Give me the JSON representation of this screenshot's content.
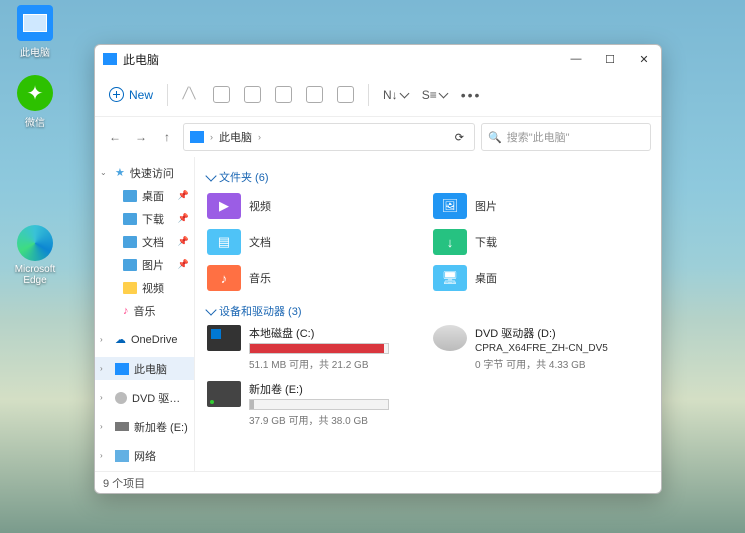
{
  "desktop": {
    "thispc": "此电脑",
    "wechat": "微信",
    "edge1": "Microsoft",
    "edge2": "Edge"
  },
  "window": {
    "title": "此电脑",
    "new_btn": "New",
    "sort": "N↓",
    "view": "S≡",
    "breadcrumb_label": "此电脑",
    "search_placeholder": "搜索\"此电脑\"",
    "status": "9 个项目"
  },
  "sidebar": {
    "quick": "快速访问",
    "desktop": "桌面",
    "downloads": "下载",
    "documents": "文档",
    "pictures": "图片",
    "videos": "视频",
    "music": "音乐",
    "onedrive": "OneDrive",
    "thispc": "此电脑",
    "dvd": "DVD 驱动器 (D:)",
    "newvol": "新加卷 (E:)",
    "network": "网络"
  },
  "sections": {
    "folders": "文件夹 (6)",
    "drives": "设备和驱动器 (3)"
  },
  "folders": {
    "videos": "视频",
    "pictures": "图片",
    "documents": "文档",
    "downloads": "下载",
    "music": "音乐",
    "desktop": "桌面"
  },
  "drives": {
    "c_name": "本地磁盘 (C:)",
    "c_sub": "51.1 MB 可用，共 21.2 GB",
    "d_name": "DVD 驱动器 (D:)",
    "d_sub1": "CPRA_X64FRE_ZH-CN_DV5",
    "d_sub2": "0 字节 可用，共 4.33 GB",
    "e_name": "新加卷 (E:)",
    "e_sub": "37.9 GB 可用，共 38.0 GB"
  }
}
